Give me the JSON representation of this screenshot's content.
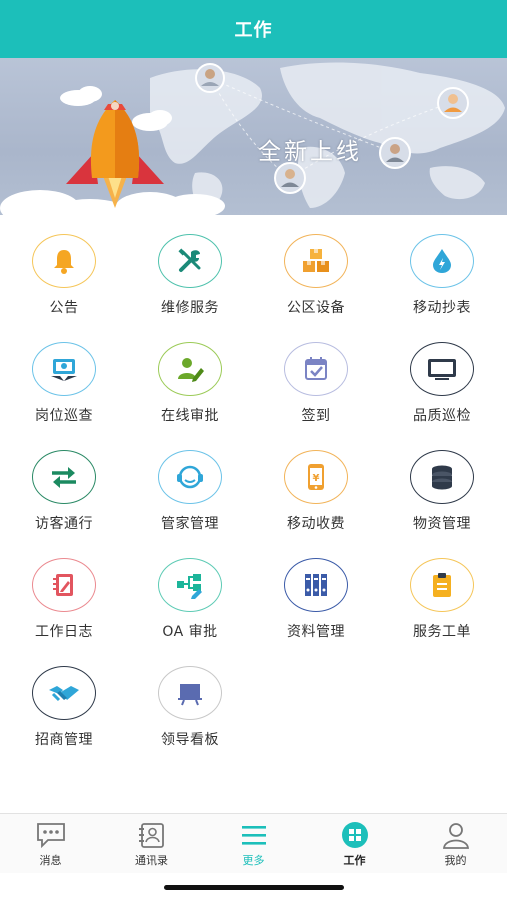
{
  "header": {
    "title": "工作"
  },
  "banner": {
    "headline": "全新上线"
  },
  "grid": {
    "items": [
      {
        "label": "公告",
        "icon": "bell-icon",
        "color": "#f5a623"
      },
      {
        "label": "维修服务",
        "icon": "tools-icon",
        "color": "#1b8a78"
      },
      {
        "label": "公区设备",
        "icon": "boxes-icon",
        "color": "#f0a030"
      },
      {
        "label": "移动抄表",
        "icon": "water-drop-icon",
        "color": "#2fa6d8"
      },
      {
        "label": "岗位巡查",
        "icon": "monitor-camera-icon",
        "color": "#2fa6d8"
      },
      {
        "label": "在线审批",
        "icon": "user-edit-icon",
        "color": "#6ba82a"
      },
      {
        "label": "签到",
        "icon": "calendar-check-icon",
        "color": "#7b84c4"
      },
      {
        "label": "品质巡检",
        "icon": "monitor-icon",
        "color": "#2f3a4a"
      },
      {
        "label": "访客通行",
        "icon": "exchange-arrows-icon",
        "color": "#1b8a60"
      },
      {
        "label": "管家管理",
        "icon": "headset-icon",
        "color": "#2fa6d8"
      },
      {
        "label": "移动收费",
        "icon": "phone-payment-icon",
        "color": "#f0a030"
      },
      {
        "label": "物资管理",
        "icon": "database-icon",
        "color": "#2f3a4a"
      },
      {
        "label": "工作日志",
        "icon": "notebook-icon",
        "color": "#e2555f"
      },
      {
        "label": "OA 审批",
        "icon": "flowchart-icon",
        "color": "#1cb59a"
      },
      {
        "label": "资料管理",
        "icon": "binders-icon",
        "color": "#3b5ba8"
      },
      {
        "label": "服务工单",
        "icon": "clipboard-icon",
        "color": "#f5b020"
      },
      {
        "label": "招商管理",
        "icon": "handshake-icon",
        "color": "#2fa6d8"
      },
      {
        "label": "领导看板",
        "icon": "board-icon",
        "color": "#5a6bb0"
      }
    ]
  },
  "tabbar": {
    "tabs": [
      {
        "label": "消息",
        "icon": "message-icon"
      },
      {
        "label": "通讯录",
        "icon": "contacts-icon"
      },
      {
        "label": "更多",
        "icon": "menu-icon"
      },
      {
        "label": "工作",
        "icon": "grid-icon"
      },
      {
        "label": "我的",
        "icon": "user-icon"
      }
    ],
    "active": "工作",
    "accent": "#1cbfba"
  }
}
